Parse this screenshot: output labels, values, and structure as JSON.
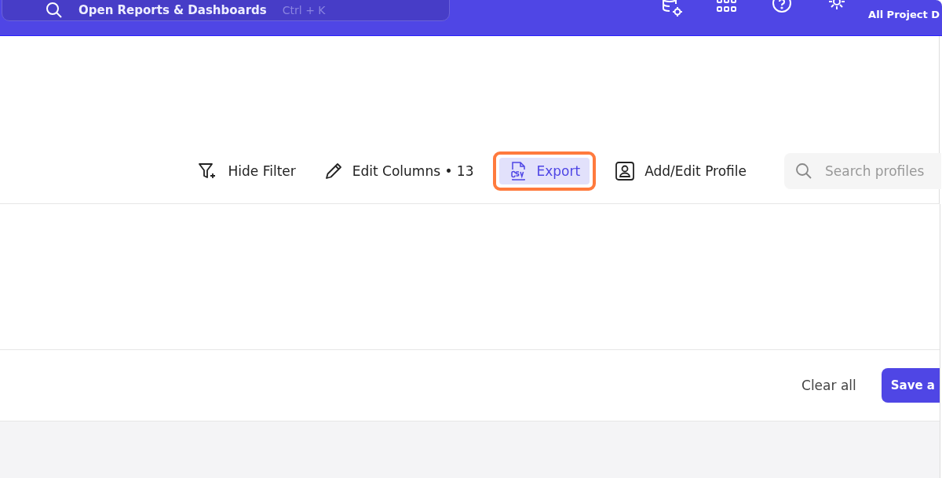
{
  "header": {
    "search": {
      "label": "Open Reports & Dashboards",
      "shortcut": "Ctrl + K"
    },
    "project": "All Project D"
  },
  "toolbar": {
    "actions": [
      {
        "label": "Hide Filter",
        "kind": "filter",
        "highlighted": false
      },
      {
        "label": "Edit Columns • 13",
        "kind": "edit",
        "highlighted": false
      },
      {
        "label": "Export",
        "kind": "export",
        "highlighted": true
      },
      {
        "label": "Add/Edit Profile",
        "kind": "profile",
        "highlighted": false
      }
    ],
    "search": {
      "placeholder": "Search profiles"
    }
  },
  "footer": {
    "buttons": [
      {
        "label": "Clear all",
        "kind": "text"
      },
      {
        "label": "Save a",
        "kind": "primary"
      }
    ]
  }
}
